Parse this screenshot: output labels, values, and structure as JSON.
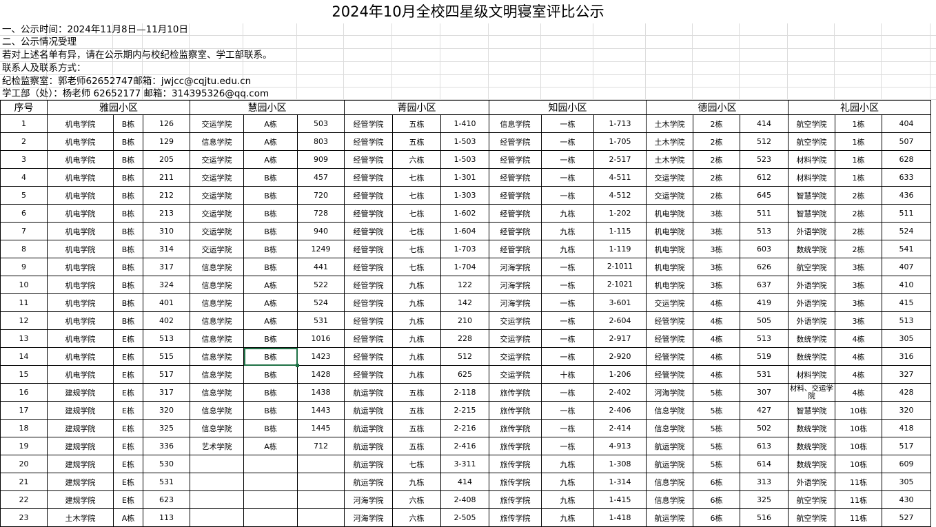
{
  "title": "2024年10月全校四星级文明寝室评比公示",
  "info_lines": [
    "一、公示时间：2024年11月8日—11月10日",
    "二、公示情况受理",
    "若对上述名单有异，请在公示期内与校纪检监察室、学工部联系。",
    "联系人及联系方式：",
    "纪检监察室：郭老师62652747邮箱：jwjcc@cqjtu.edu.cn",
    "学工部（处）：杨老师 62652177 邮箱：314395326@qq.com"
  ],
  "headers": [
    "序号",
    "雅园小区",
    "慧园小区",
    "菁园小区",
    "知园小区",
    "德园小区",
    "礼园小区"
  ],
  "rows": [
    [
      "1",
      "机电学院",
      "B栋",
      "126",
      "交运学院",
      "A栋",
      "503",
      "经管学院",
      "五栋",
      "1-410",
      "信息学院",
      "一栋",
      "1-713",
      "土木学院",
      "2栋",
      "414",
      "航空学院",
      "1栋",
      "404"
    ],
    [
      "2",
      "机电学院",
      "B栋",
      "129",
      "信息学院",
      "A栋",
      "803",
      "经管学院",
      "五栋",
      "1-503",
      "经管学院",
      "一栋",
      "1-705",
      "土木学院",
      "2栋",
      "512",
      "航空学院",
      "1栋",
      "507"
    ],
    [
      "3",
      "机电学院",
      "B栋",
      "205",
      "交运学院",
      "A栋",
      "909",
      "经管学院",
      "六栋",
      "1-503",
      "经管学院",
      "一栋",
      "2-517",
      "土木学院",
      "2栋",
      "523",
      "材料学院",
      "1栋",
      "628"
    ],
    [
      "4",
      "机电学院",
      "B栋",
      "211",
      "交运学院",
      "B栋",
      "457",
      "经管学院",
      "七栋",
      "1-301",
      "经管学院",
      "一栋",
      "4-511",
      "交运学院",
      "2栋",
      "612",
      "材料学院",
      "1栋",
      "633"
    ],
    [
      "5",
      "机电学院",
      "B栋",
      "212",
      "交运学院",
      "B栋",
      "720",
      "经管学院",
      "七栋",
      "1-303",
      "经管学院",
      "一栋",
      "4-512",
      "交运学院",
      "2栋",
      "645",
      "智慧学院",
      "2栋",
      "436"
    ],
    [
      "6",
      "机电学院",
      "B栋",
      "213",
      "交运学院",
      "B栋",
      "728",
      "经管学院",
      "七栋",
      "1-602",
      "经管学院",
      "九栋",
      "1-202",
      "机电学院",
      "3栋",
      "511",
      "智慧学院",
      "2栋",
      "511"
    ],
    [
      "7",
      "机电学院",
      "B栋",
      "310",
      "交运学院",
      "B栋",
      "940",
      "经管学院",
      "七栋",
      "1-604",
      "经管学院",
      "九栋",
      "1-115",
      "机电学院",
      "3栋",
      "513",
      "外语学院",
      "2栋",
      "524"
    ],
    [
      "8",
      "机电学院",
      "B栋",
      "314",
      "交运学院",
      "B栋",
      "1249",
      "经管学院",
      "七栋",
      "1-703",
      "经管学院",
      "九栋",
      "1-119",
      "机电学院",
      "3栋",
      "603",
      "数统学院",
      "2栋",
      "541"
    ],
    [
      "9",
      "机电学院",
      "B栋",
      "317",
      "信息学院",
      "B栋",
      "441",
      "经管学院",
      "七栋",
      "1-704",
      "河海学院",
      "一栋",
      "2-1011",
      "机电学院",
      "3栋",
      "626",
      "航空学院",
      "3栋",
      "407"
    ],
    [
      "10",
      "机电学院",
      "B栋",
      "324",
      "信息学院",
      "A栋",
      "522",
      "经管学院",
      "九栋",
      "122",
      "河海学院",
      "一栋",
      "2-1021",
      "机电学院",
      "3栋",
      "637",
      "外语学院",
      "3栋",
      "410"
    ],
    [
      "11",
      "机电学院",
      "B栋",
      "401",
      "信息学院",
      "A栋",
      "524",
      "经管学院",
      "九栋",
      "142",
      "河海学院",
      "一栋",
      "3-601",
      "交运学院",
      "4栋",
      "419",
      "外语学院",
      "3栋",
      "415"
    ],
    [
      "12",
      "机电学院",
      "B栋",
      "402",
      "信息学院",
      "A栋",
      "531",
      "经管学院",
      "九栋",
      "210",
      "交运学院",
      "一栋",
      "2-604",
      "经管学院",
      "4栋",
      "505",
      "外语学院",
      "3栋",
      "513"
    ],
    [
      "13",
      "机电学院",
      "E栋",
      "513",
      "信息学院",
      "B栋",
      "1016",
      "经管学院",
      "九栋",
      "228",
      "交运学院",
      "一栋",
      "2-917",
      "经管学院",
      "4栋",
      "513",
      "数统学院",
      "4栋",
      "305"
    ],
    [
      "14",
      "机电学院",
      "E栋",
      "515",
      "信息学院",
      "B栋",
      "1423",
      "经管学院",
      "九栋",
      "512",
      "交运学院",
      "一栋",
      "2-920",
      "经管学院",
      "4栋",
      "519",
      "数统学院",
      "4栋",
      "316"
    ],
    [
      "15",
      "机电学院",
      "E栋",
      "517",
      "信息学院",
      "B栋",
      "1428",
      "经管学院",
      "九栋",
      "625",
      "交运学院",
      "十栋",
      "1-206",
      "经管学院",
      "4栋",
      "531",
      "材料学院",
      "4栋",
      "327"
    ],
    [
      "16",
      "建规学院",
      "E栋",
      "317",
      "信息学院",
      "B栋",
      "1438",
      "航运学院",
      "五栋",
      "2-118",
      "旅传学院",
      "一栋",
      "2-402",
      "河海学院",
      "5栋",
      "307",
      "材料、交运学院",
      "4栋",
      "428"
    ],
    [
      "17",
      "建规学院",
      "E栋",
      "320",
      "信息学院",
      "B栋",
      "1443",
      "航运学院",
      "五栋",
      "2-215",
      "旅传学院",
      "一栋",
      "2-406",
      "信息学院",
      "5栋",
      "427",
      "智慧学院",
      "10栋",
      "320"
    ],
    [
      "18",
      "建规学院",
      "E栋",
      "325",
      "信息学院",
      "B栋",
      "1445",
      "航运学院",
      "五栋",
      "2-216",
      "旅传学院",
      "一栋",
      "2-414",
      "信息学院",
      "5栋",
      "502",
      "数统学院",
      "10栋",
      "418"
    ],
    [
      "19",
      "建规学院",
      "E栋",
      "336",
      "艺术学院",
      "A栋",
      "712",
      "航运学院",
      "五栋",
      "2-416",
      "旅传学院",
      "一栋",
      "4-913",
      "航运学院",
      "5栋",
      "613",
      "数统学院",
      "10栋",
      "517"
    ],
    [
      "20",
      "建规学院",
      "E栋",
      "530",
      "",
      "",
      "",
      "航运学院",
      "七栋",
      "3-311",
      "旅传学院",
      "九栋",
      "1-308",
      "航运学院",
      "5栋",
      "614",
      "数统学院",
      "10栋",
      "609"
    ],
    [
      "21",
      "建规学院",
      "E栋",
      "531",
      "",
      "",
      "",
      "航运学院",
      "九栋",
      "414",
      "旅传学院",
      "九栋",
      "1-314",
      "信息学院",
      "6栋",
      "313",
      "外语学院",
      "11栋",
      "305"
    ],
    [
      "22",
      "建规学院",
      "E栋",
      "623",
      "",
      "",
      "",
      "河海学院",
      "六栋",
      "2-408",
      "旅传学院",
      "九栋",
      "1-415",
      "信息学院",
      "6栋",
      "325",
      "航空学院",
      "11栋",
      "430"
    ],
    [
      "23",
      "土木学院",
      "A栋",
      "113",
      "",
      "",
      "",
      "河海学院",
      "六栋",
      "2-505",
      "旅传学院",
      "九栋",
      "1-418",
      "航运学院",
      "6栋",
      "516",
      "航空学院",
      "11栋",
      "527"
    ]
  ],
  "selected_cell": {
    "row": 13,
    "col": 5
  },
  "colors": {
    "selection": "#1e7145",
    "gridline": "#dcdcdc",
    "border": "#000000"
  }
}
